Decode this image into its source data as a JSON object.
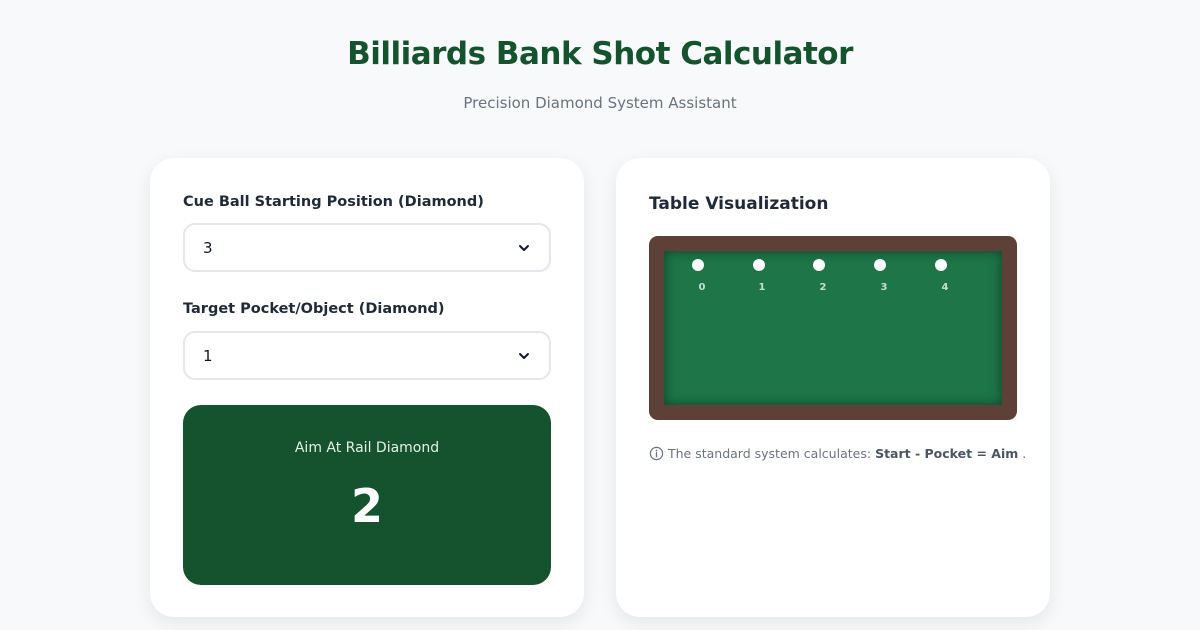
{
  "header": {
    "title": "Billiards Bank Shot Calculator",
    "subtitle": "Precision Diamond System Assistant"
  },
  "inputs": {
    "start_label": "Cue Ball Starting Position (Diamond)",
    "start_value": "3",
    "target_label": "Target Pocket/Object (Diamond)",
    "target_value": "1"
  },
  "result": {
    "label": "Aim At Rail Diamond",
    "value": "2"
  },
  "visualization": {
    "title": "Table Visualization",
    "diamonds": [
      "0",
      "1",
      "2",
      "3",
      "4"
    ],
    "info_prefix": "The standard system calculates: ",
    "info_formula": "Start - Pocket = Aim",
    "info_suffix": "."
  },
  "colors": {
    "brand": "#14532d",
    "felt": "#1d7548",
    "rail": "#5d4037"
  },
  "icons": {
    "select_caret": "chevron-down-icon",
    "info": "info-icon"
  }
}
